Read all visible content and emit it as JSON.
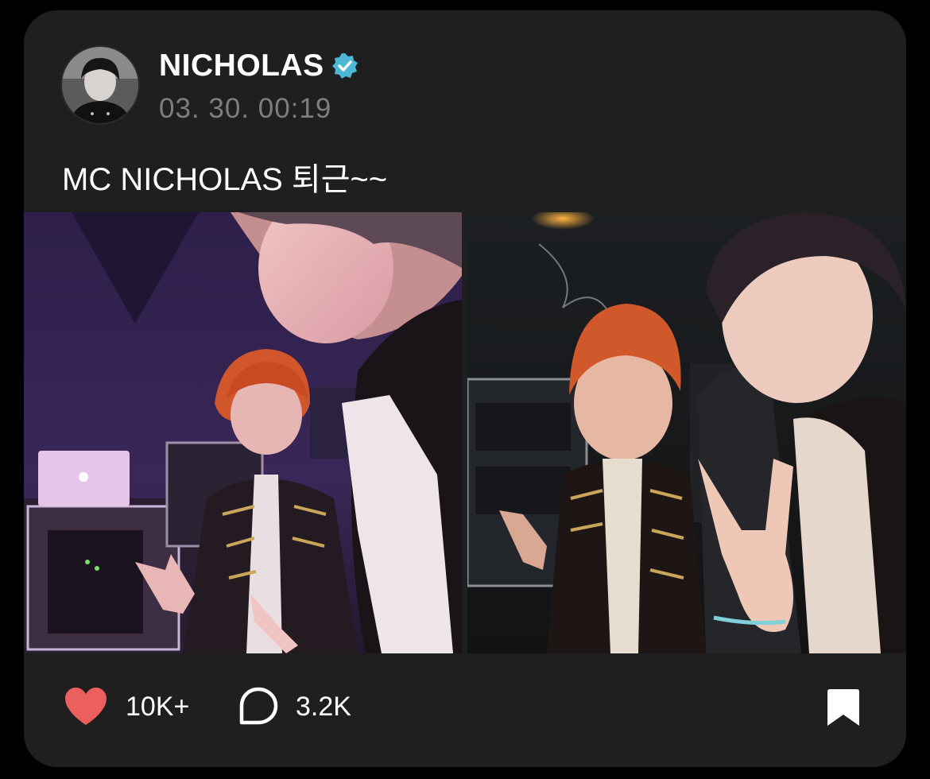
{
  "post": {
    "username": "NICHOLAS",
    "timestamp": "03. 30. 00:19",
    "text": "MC NICHOLAS 퇴근~~",
    "photos": [
      "selfie-left",
      "selfie-right"
    ]
  },
  "actions": {
    "likes": "10K+",
    "comments": "3.2K"
  },
  "icons": {
    "verified": "verified-badge-icon",
    "like": "heart-icon",
    "comment": "comment-bubble-icon",
    "bookmark": "bookmark-icon"
  },
  "colors": {
    "card_background": "#1f1f1f",
    "verified_badge": "#4fb7d6",
    "like_heart": "#ec5f5f",
    "timestamp": "#7e7e7e"
  }
}
